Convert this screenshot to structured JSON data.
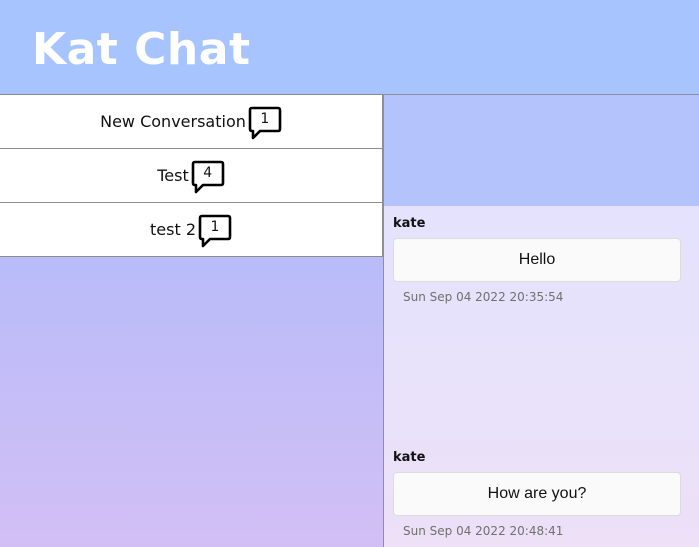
{
  "app": {
    "title": "Kat Chat"
  },
  "conversations": [
    {
      "name": "New Conversation",
      "count": "1"
    },
    {
      "name": "Test",
      "count": "4"
    },
    {
      "name": "test 2",
      "count": "1"
    }
  ],
  "messages": [
    {
      "author": "kate",
      "text": "Hello",
      "timestamp": "Sun Sep 04 2022 20:35:54"
    },
    {
      "author": "kate",
      "text": "How are you?",
      "timestamp": "Sun Sep 04 2022 20:48:41"
    }
  ],
  "colors": {
    "header_bg": "#a7c4fe",
    "title_text": "#ffffff",
    "chat_top_bg": "#b5c3fc"
  },
  "icons": {
    "message_count": "speech-bubble-icon"
  }
}
